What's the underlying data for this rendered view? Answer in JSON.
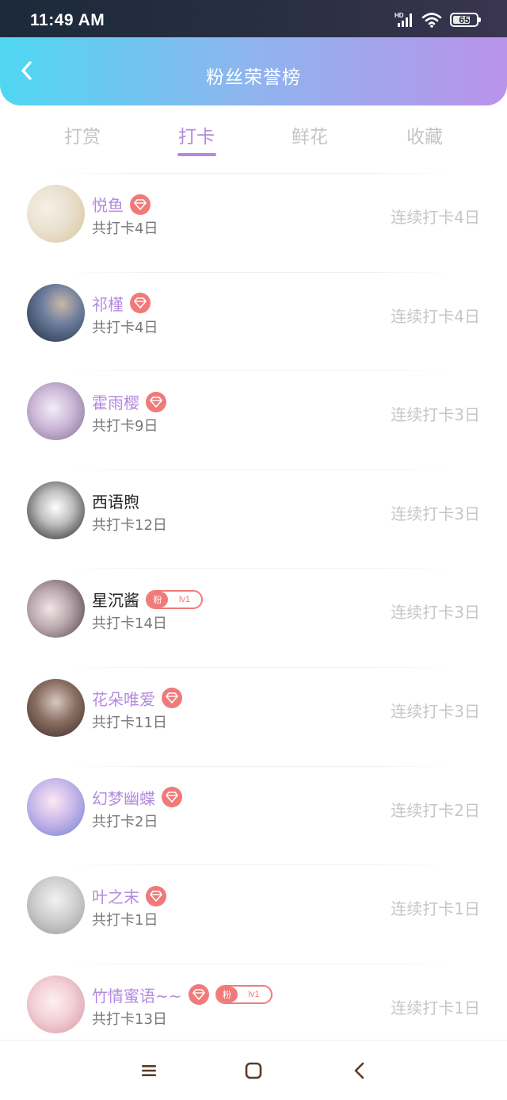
{
  "status_bar": {
    "time": "11:49 AM",
    "battery": "65"
  },
  "header": {
    "title": "粉丝荣誉榜"
  },
  "tabs": [
    {
      "label": "打赏",
      "active": false
    },
    {
      "label": "打卡",
      "active": true
    },
    {
      "label": "鲜花",
      "active": false
    },
    {
      "label": "收藏",
      "active": false
    }
  ],
  "colors": {
    "accent": "#b38adf",
    "badge": "#f07a7a",
    "header_start": "#4fd7f2",
    "header_end": "#b993ea"
  },
  "users": [
    {
      "name": "悦鱼",
      "total": "共打卡4日",
      "streak": "连续打卡4日",
      "diamond": true,
      "fan": false,
      "highlight": true
    },
    {
      "name": "祁槿",
      "total": "共打卡4日",
      "streak": "连续打卡4日",
      "diamond": true,
      "fan": false,
      "highlight": true
    },
    {
      "name": "霍雨樱",
      "total": "共打卡9日",
      "streak": "连续打卡3日",
      "diamond": true,
      "fan": false,
      "highlight": true
    },
    {
      "name": "西语煦",
      "total": "共打卡12日",
      "streak": "连续打卡3日",
      "diamond": false,
      "fan": false,
      "highlight": false
    },
    {
      "name": "星沉酱",
      "total": "共打卡14日",
      "streak": "连续打卡3日",
      "diamond": false,
      "fan": true,
      "highlight": false
    },
    {
      "name": "花朵唯爱",
      "total": "共打卡11日",
      "streak": "连续打卡3日",
      "diamond": true,
      "fan": false,
      "highlight": true
    },
    {
      "name": "幻梦幽蝶",
      "total": "共打卡2日",
      "streak": "连续打卡2日",
      "diamond": true,
      "fan": false,
      "highlight": true
    },
    {
      "name": "叶之末",
      "total": "共打卡1日",
      "streak": "连续打卡1日",
      "diamond": true,
      "fan": false,
      "highlight": true
    },
    {
      "name": "竹情蜜语~~",
      "total": "共打卡13日",
      "streak": "连续打卡1日",
      "diamond": true,
      "fan": true,
      "highlight": true
    }
  ],
  "fan_badge": {
    "label": "粉",
    "level": "lv1"
  },
  "nav": {
    "menu_icon": "menu-icon",
    "home_icon": "home-icon",
    "back_icon": "back-icon"
  }
}
